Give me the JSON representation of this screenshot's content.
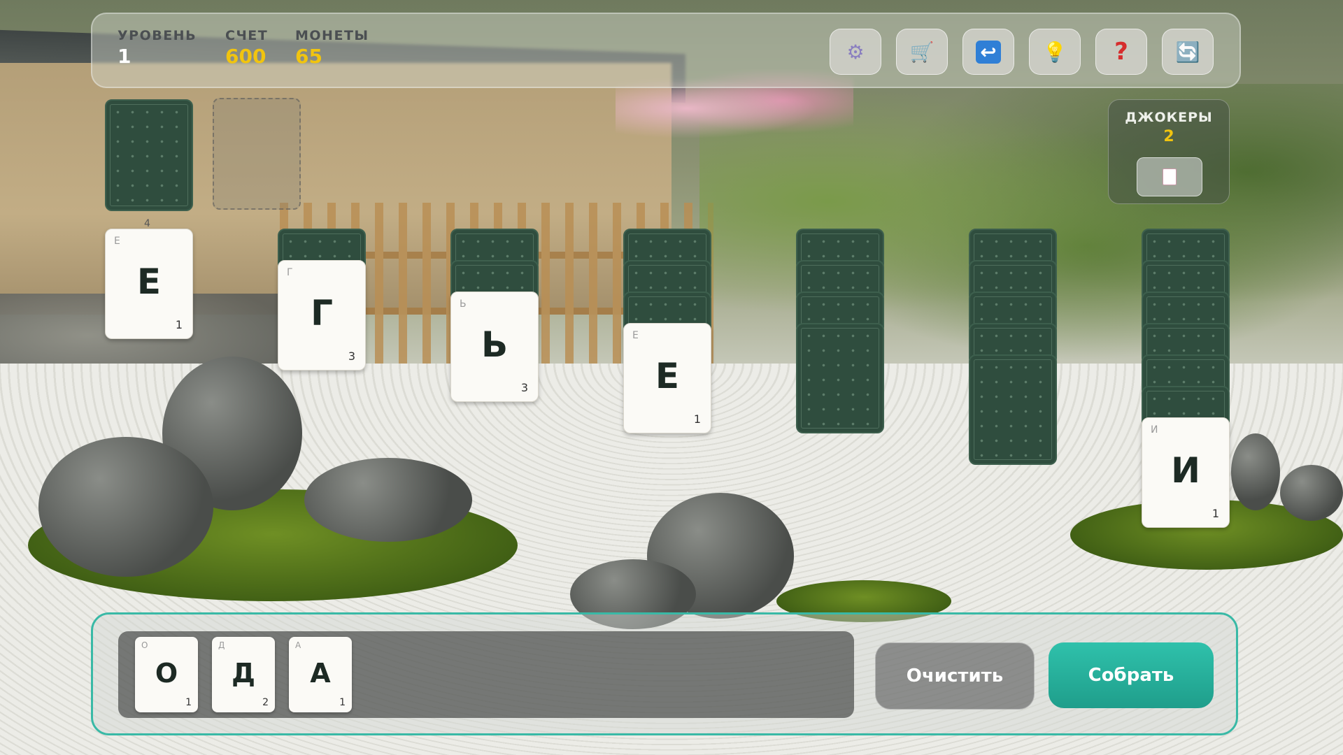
{
  "hud": {
    "level_label": "УРОВЕНЬ",
    "level_value": "1",
    "score_label": "СЧЕТ",
    "score_value": "600",
    "coins_label": "МОНЕТЫ",
    "coins_value": "65",
    "buttons": [
      {
        "name": "settings-button",
        "icon": "gear-icon",
        "glyph": "⚙"
      },
      {
        "name": "shop-button",
        "icon": "shopping-cart-icon",
        "glyph": "🛒"
      },
      {
        "name": "undo-button",
        "icon": "undo-arrow-icon",
        "glyph": "↩"
      },
      {
        "name": "hint-button",
        "icon": "lightbulb-icon",
        "glyph": "💡"
      },
      {
        "name": "help-button",
        "icon": "question-mark-icon",
        "glyph": "?"
      },
      {
        "name": "shuffle-button",
        "icon": "refresh-icon",
        "glyph": "🔄"
      }
    ]
  },
  "stock": {
    "count": "4"
  },
  "jokers": {
    "label": "ДЖОКЕРЫ",
    "count": "2",
    "icon": "joker-card-icon"
  },
  "tableau": [
    {
      "letter": "Е",
      "corner": "Е",
      "points": "1"
    },
    {
      "letter": "Г",
      "corner": "Г",
      "points": "3"
    },
    {
      "letter": "Ь",
      "corner": "Ь",
      "points": "3"
    },
    {
      "letter": "Е",
      "corner": "Е",
      "points": "1"
    },
    {
      "letter": "",
      "corner": "",
      "points": ""
    },
    {
      "letter": "",
      "corner": "",
      "points": ""
    },
    {
      "letter": "И",
      "corner": "И",
      "points": "1"
    }
  ],
  "word": {
    "tiles": [
      {
        "letter": "О",
        "corner": "О",
        "points": "1"
      },
      {
        "letter": "Д",
        "corner": "Д",
        "points": "2"
      },
      {
        "letter": "А",
        "corner": "А",
        "points": "1"
      }
    ],
    "clear_label": "Очистить",
    "submit_label": "Собрать"
  },
  "colors": {
    "accent": "#2bb5a0",
    "score_yellow": "#f1c40f",
    "card_back": "#2f4d3e"
  }
}
